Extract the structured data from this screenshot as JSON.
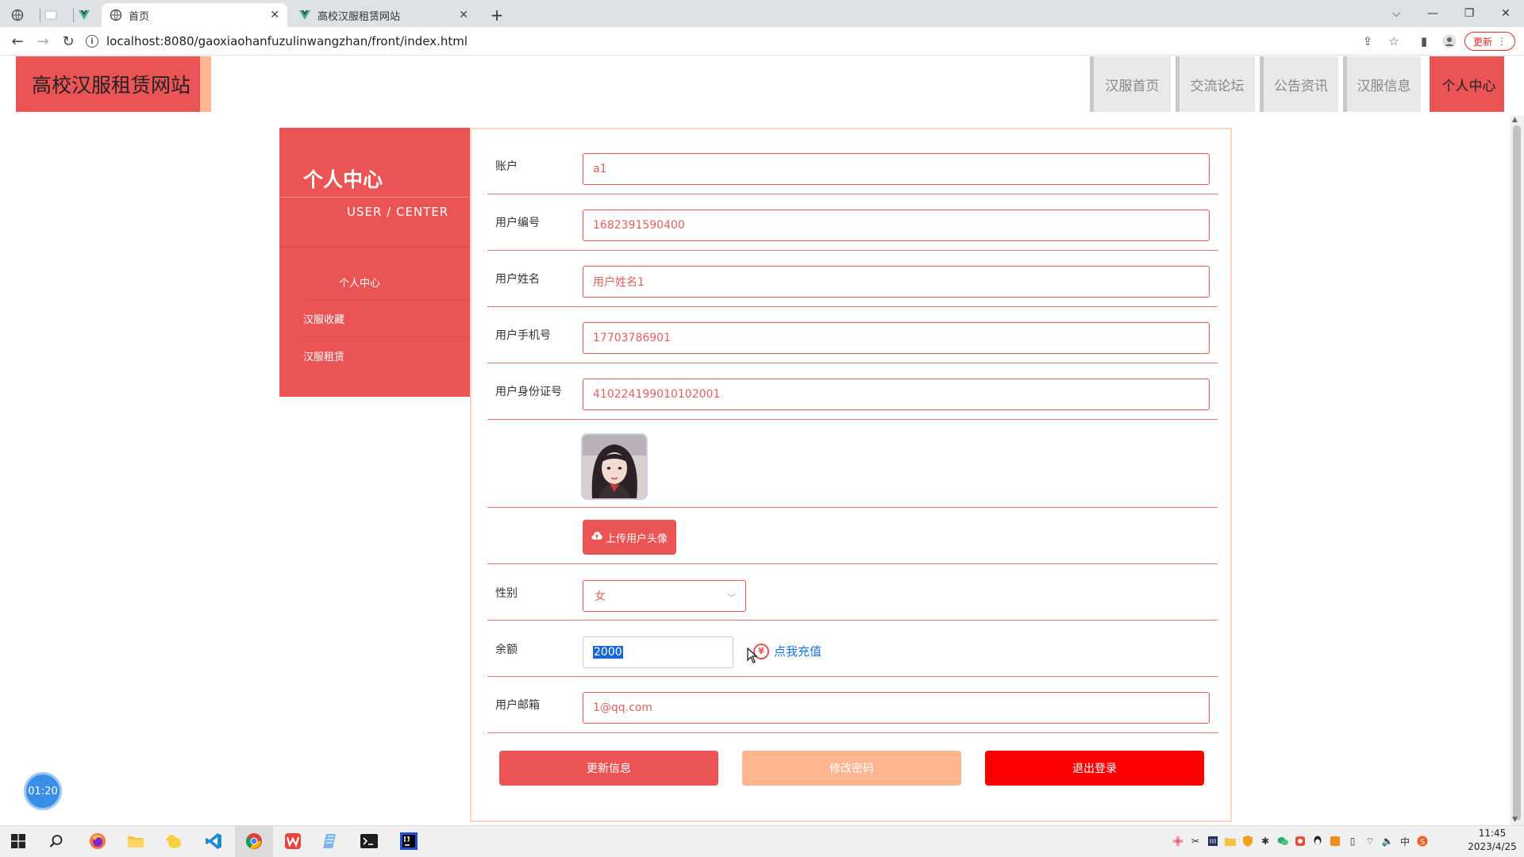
{
  "browser": {
    "tabs": [
      {
        "title": ""
      },
      {
        "title": ""
      },
      {
        "title": ""
      },
      {
        "title": "首页"
      },
      {
        "title": "高校汉服租赁网站"
      }
    ],
    "url": "localhost:8080/gaoxiaohanfuzulinwangzhan/front/index.html",
    "update_label": "更新"
  },
  "site": {
    "title": "高校汉服租赁网站",
    "nav": [
      "汉服首页",
      "交流论坛",
      "公告资讯",
      "汉服信息",
      "个人中心"
    ],
    "active_nav_index": 4
  },
  "sidebar": {
    "title": "个人中心",
    "subtitle": "USER / CENTER",
    "items": [
      "个人中心",
      "汉服收藏",
      "汉服租赁"
    ]
  },
  "form": {
    "account": {
      "label": "账户",
      "value": "a1"
    },
    "user_no": {
      "label": "用户编号",
      "value": "1682391590400"
    },
    "user_name": {
      "label": "用户姓名",
      "value": "用户姓名1"
    },
    "phone": {
      "label": "用户手机号",
      "value": "17703786901"
    },
    "id_card": {
      "label": "用户身份证号",
      "value": "410224199010102001"
    },
    "upload_avatar_label": "上传用户头像",
    "gender": {
      "label": "性别",
      "value": "女"
    },
    "balance": {
      "label": "余额",
      "value": "2000",
      "recharge_label": "点我充值"
    },
    "email": {
      "label": "用户邮箱",
      "value": "1@qq.com"
    }
  },
  "actions": {
    "update": "更新信息",
    "change_password": "修改密码",
    "logout": "退出登录"
  },
  "colors": {
    "primary": "#ea5455",
    "accent": "#ffb58f",
    "logout": "#ff0000",
    "link": "#1a73e8"
  },
  "timer": "01:20",
  "clock": {
    "time": "11:45",
    "date": "2023/4/25"
  },
  "tray": {
    "ime": "中"
  }
}
